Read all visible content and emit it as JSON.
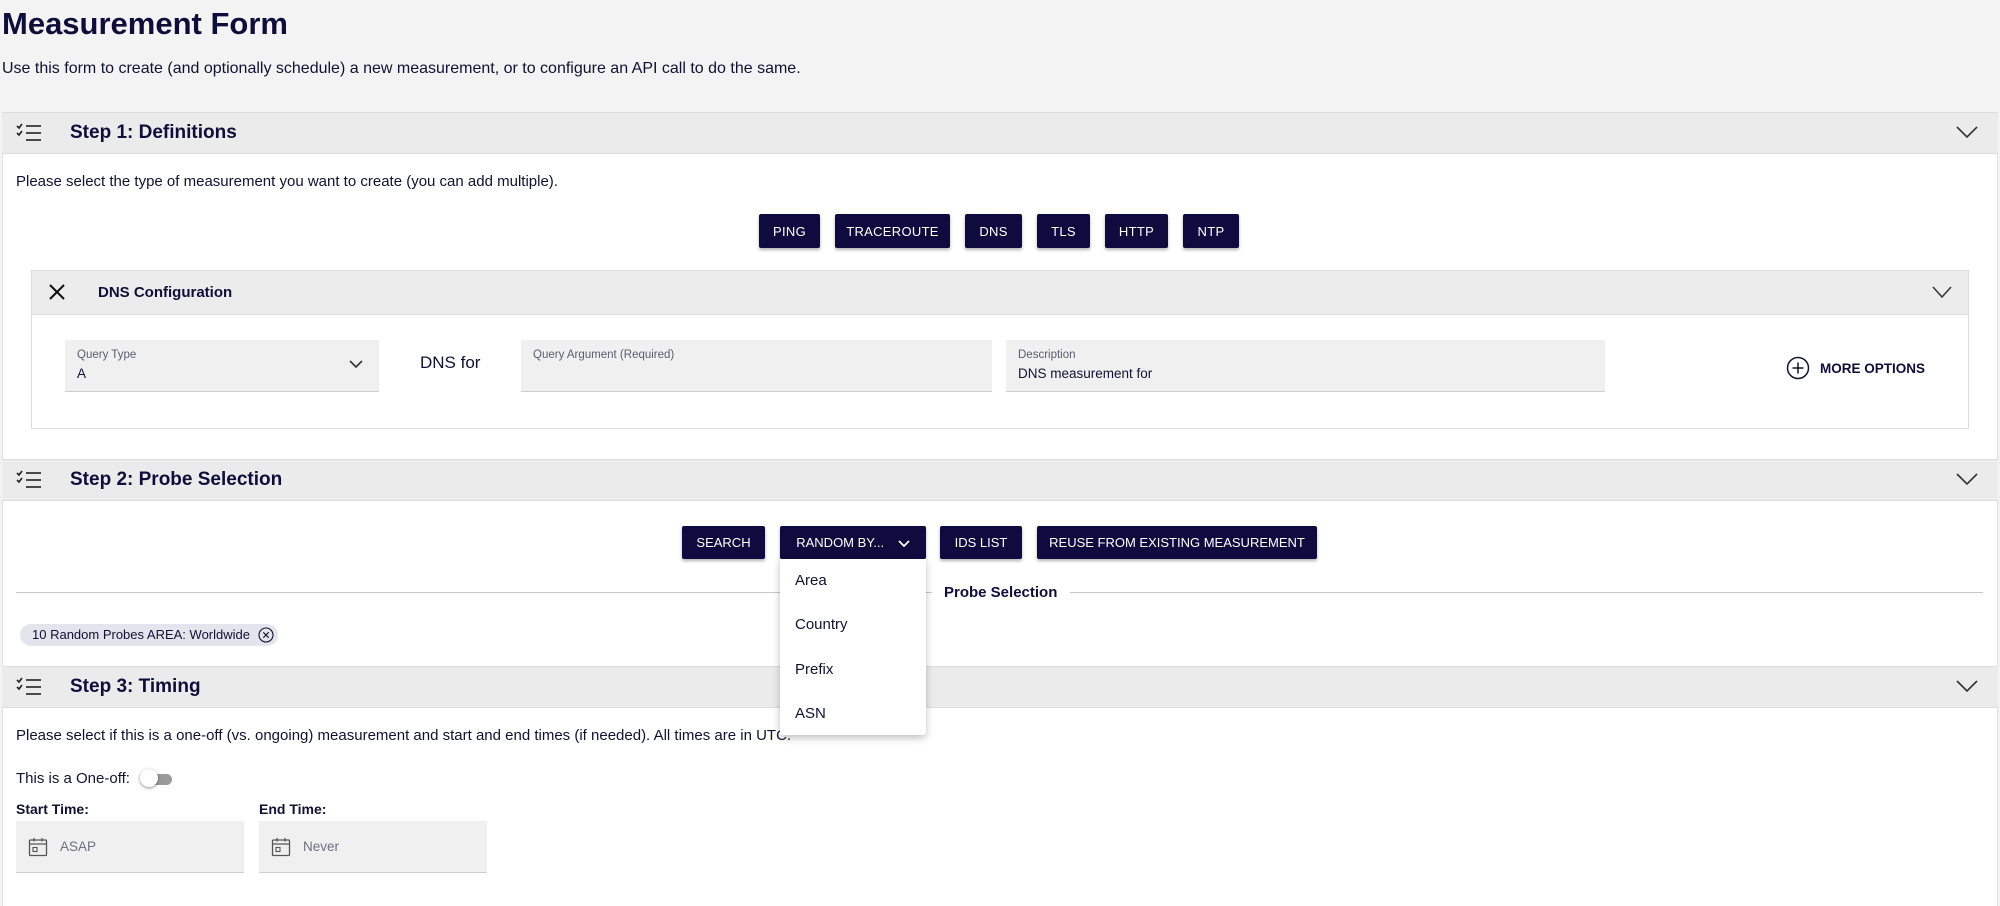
{
  "page": {
    "title": "Measurement Form",
    "description": "Use this form to create (and optionally schedule) a new measurement, or to configure an API call to do the same."
  },
  "step1": {
    "title": "Step 1: Definitions",
    "instruction": "Please select the type of measurement you want to create (you can add multiple).",
    "type_buttons": [
      "PING",
      "TRACEROUTE",
      "DNS",
      "TLS",
      "HTTP",
      "NTP"
    ],
    "dns_config": {
      "title": "DNS Configuration",
      "query_type_label": "Query Type",
      "query_type_value": "A",
      "dns_for_text": "DNS for",
      "query_argument_label": "Query Argument (Required)",
      "query_argument_value": "",
      "description_label": "Description",
      "description_value": "DNS measurement for",
      "more_options": "MORE OPTIONS"
    }
  },
  "step2": {
    "title": "Step 2: Probe Selection",
    "buttons": {
      "search": "SEARCH",
      "random_by": "RANDOM BY...",
      "ids_list": "IDS LIST",
      "reuse": "REUSE FROM EXISTING MEASUREMENT"
    },
    "random_by_options": [
      "Area",
      "Country",
      "Prefix",
      "ASN"
    ],
    "divider_label": "Probe Selection",
    "chips": [
      "10 Random Probes AREA: Worldwide"
    ]
  },
  "step3": {
    "title": "Step 3: Timing",
    "instruction": "Please select if this is a one-off (vs. ongoing) measurement and start and end times (if needed). All times are in UTC.",
    "one_off_label": "This is a One-off:",
    "one_off_on": false,
    "start_label": "Start Time:",
    "start_placeholder": "ASAP",
    "end_label": "End Time:",
    "end_placeholder": "Never"
  },
  "colors": {
    "primary": "#0f0b3e",
    "header_bg": "#ebebeb",
    "field_bg": "#f0f0f0",
    "page_bg": "#f3f3f3"
  }
}
